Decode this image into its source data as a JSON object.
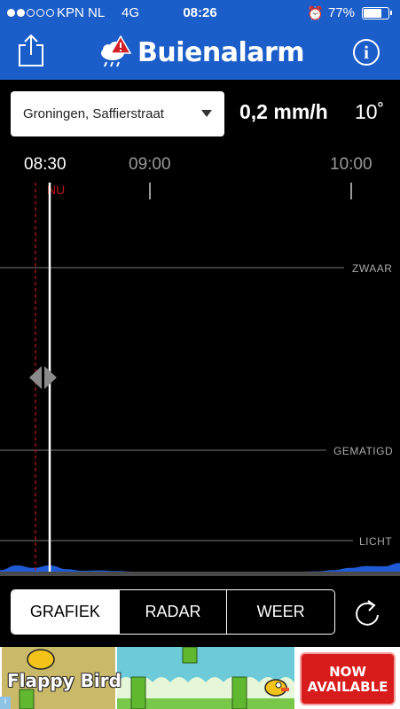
{
  "status_bar": {
    "signal_bars_filled": 2,
    "signal_bars_total": 5,
    "carrier": "KPN NL",
    "network": "4G",
    "time": "08:26",
    "battery": "77%",
    "battery_level": 0.77
  },
  "header": {
    "app_name": "Buienalarm",
    "share_icon": "share-icon",
    "info_icon": "info-icon",
    "info_glyph": "i",
    "logo_icon": "rain-cloud-warning-icon"
  },
  "location": {
    "value": "Groningen, Saffierstraat"
  },
  "current": {
    "rain": "0,2 mm/h",
    "temperature": "10˚"
  },
  "timeline": {
    "current_time": "08:30",
    "labels": [
      "09:00",
      "10:00"
    ],
    "now_label": "NU"
  },
  "chart_data": {
    "type": "area",
    "x": [
      "08:25",
      "08:30",
      "08:35",
      "08:40",
      "08:45",
      "08:50",
      "08:55",
      "09:00",
      "09:05",
      "09:10",
      "09:15",
      "09:20",
      "09:25",
      "09:30",
      "09:35",
      "09:40",
      "09:45",
      "09:50",
      "09:55",
      "10:00",
      "10:05",
      "10:10",
      "10:15",
      "10:20",
      "10:25"
    ],
    "series": [
      {
        "values": [
          0.05,
          0.2,
          0.12,
          0.2,
          0.08,
          0.03,
          0.04,
          0.02,
          0,
          0,
          0,
          0,
          0,
          0,
          0,
          0,
          0,
          0,
          0,
          0.01,
          0.05,
          0.12,
          0.18,
          0.17,
          0.28
        ]
      }
    ],
    "levels": [
      "ZWAAR",
      "GEMATIGD",
      "LICHT"
    ],
    "colors": {
      "fill": "#1f5bd6",
      "now_line": "#c0141c",
      "cursor": "#ffffff",
      "gridline": "#777777"
    }
  },
  "tabs": [
    "GRAFIEK",
    "RADAR",
    "WEER"
  ],
  "selected_tab": "GRAFIEK",
  "refresh_icon": "refresh-icon",
  "ad": {
    "title": "Flappy Bird",
    "cta": "NOW AVAILABLE",
    "badge": "i"
  }
}
